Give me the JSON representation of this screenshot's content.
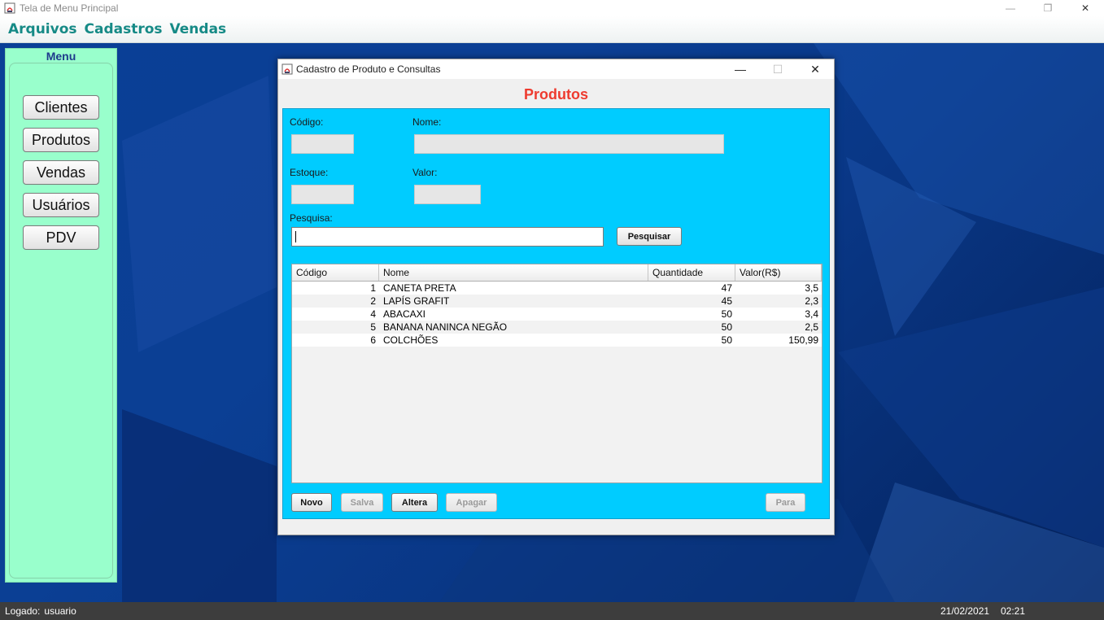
{
  "window": {
    "title": "Tela de Menu Principal",
    "controls": {
      "minimize": "—",
      "restore": "❐",
      "close": "✕"
    }
  },
  "menubar": {
    "items": [
      "Arquivos",
      "Cadastros",
      "Vendas"
    ]
  },
  "menu_panel": {
    "title": "Menu",
    "buttons": [
      "Clientes",
      "Produtos",
      "Vendas",
      "Usuários",
      "PDV"
    ]
  },
  "product_window": {
    "title": "Cadastro de Produto e Consultas",
    "controls": {
      "minimize": "—",
      "maximize": "☐",
      "close": "✕"
    },
    "heading": "Produtos",
    "labels": {
      "codigo": "Código:",
      "nome": "Nome:",
      "estoque": "Estoque:",
      "valor": "Valor:",
      "pesquisa": "Pesquisa:"
    },
    "fields": {
      "codigo": "",
      "nome": "",
      "estoque": "",
      "valor": "",
      "pesquisa": ""
    },
    "search_button": "Pesquisar",
    "table": {
      "columns": [
        "Código",
        "Nome",
        "Quantidade",
        "Valor(R$)"
      ],
      "rows": [
        {
          "codigo": "1",
          "nome": "CANETA PRETA",
          "quantidade": "47",
          "valor": "3,5"
        },
        {
          "codigo": "2",
          "nome": "LAPÍS GRAFIT",
          "quantidade": "45",
          "valor": "2,3"
        },
        {
          "codigo": "4",
          "nome": "ABACAXI",
          "quantidade": "50",
          "valor": "3,4"
        },
        {
          "codigo": "5",
          "nome": "BANANA NANINCA NEGÃO",
          "quantidade": "50",
          "valor": "2,5"
        },
        {
          "codigo": "6",
          "nome": "COLCHÕES",
          "quantidade": "50",
          "valor": "150,99"
        }
      ]
    },
    "buttons": {
      "novo": "Novo",
      "salva": "Salva",
      "altera": "Altera",
      "apagar": "Apagar",
      "para": "Para"
    },
    "colors": {
      "panel": "#00ccff",
      "heading": "#ee3b2f"
    }
  },
  "statusbar": {
    "user_label": "Logado:",
    "user_value": "usuario",
    "date": "21/02/2021",
    "time": "02:21"
  },
  "colors": {
    "menu_panel": "#99ffcc",
    "menu_text": "#168a86",
    "desktop": "#0a3f96"
  }
}
